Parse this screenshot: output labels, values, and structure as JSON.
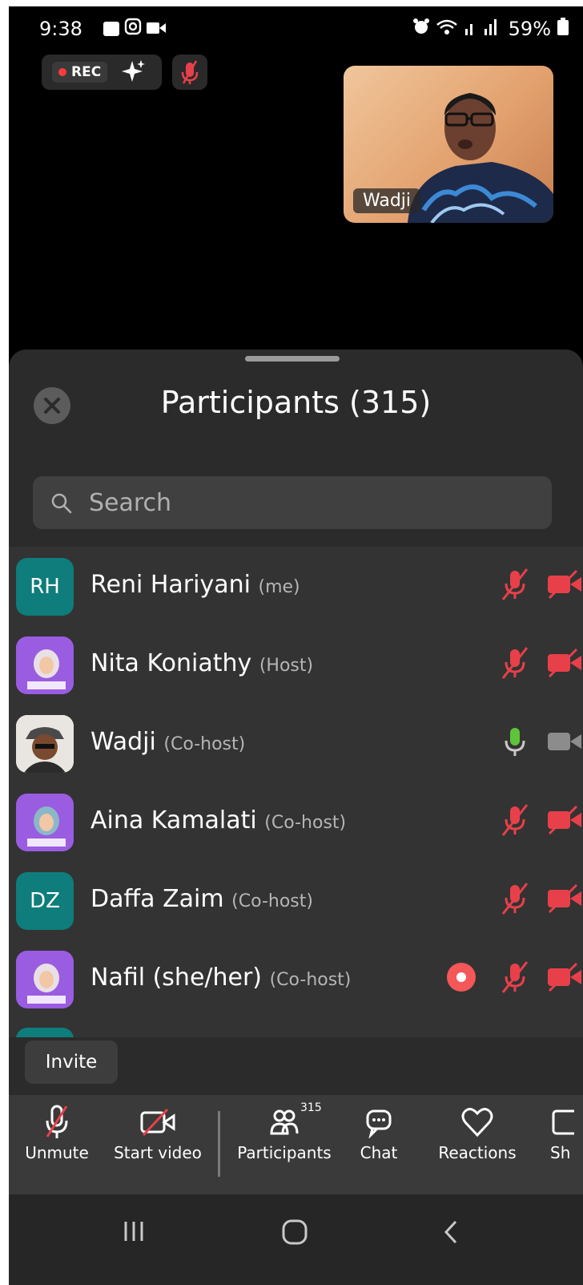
{
  "status_bar": {
    "time": "9:38",
    "battery": "59%"
  },
  "meeting": {
    "rec_label": "REC",
    "active_speaker": "Wadji"
  },
  "sheet": {
    "title": "Participants (315)",
    "search_placeholder": "Search",
    "participants": [
      {
        "initials": "RH",
        "name": "Reni Hariyani",
        "role": "(me)",
        "mic": "muted",
        "video": "off"
      },
      {
        "initials": "",
        "name": "Nita Koniathy",
        "role": "(Host)",
        "mic": "muted",
        "video": "off"
      },
      {
        "initials": "",
        "name": "Wadji",
        "role": "(Co-host)",
        "mic": "on",
        "video": "off-gray"
      },
      {
        "initials": "",
        "name": "Aina Kamalati",
        "role": "(Co-host)",
        "mic": "muted",
        "video": "off"
      },
      {
        "initials": "DZ",
        "name": "Daffa Zaim",
        "role": "(Co-host)",
        "mic": "muted",
        "video": "off"
      },
      {
        "initials": "",
        "name": "Nafil (she/her)",
        "role": "(Co-host)",
        "mic": "muted",
        "video": "off",
        "recording": true
      }
    ],
    "invite_label": "Invite"
  },
  "toolbar": {
    "unmute": "Unmute",
    "start_video": "Start video",
    "participants": "Participants",
    "participants_count": "315",
    "chat": "Chat",
    "reactions": "Reactions",
    "share": "Sh"
  },
  "colors": {
    "muted_red": "#e8404a",
    "mic_green": "#5ec43a",
    "teal": "#0e7d7b",
    "purple": "#8f56d8"
  }
}
